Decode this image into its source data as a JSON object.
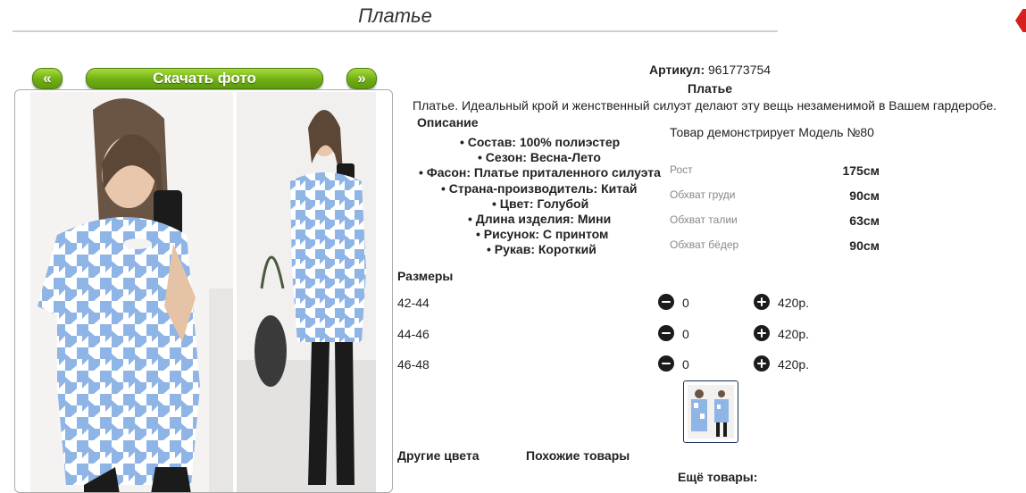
{
  "header": {
    "title": "Платье"
  },
  "gallery": {
    "prev_label": "«",
    "download_label": "Скачать фото",
    "next_label": "»"
  },
  "product": {
    "article_label": "Артикул:",
    "article_value": "961773754",
    "name": "Платье",
    "description": "Платье. Идеальный крой и женственный силуэт делают эту вещь незаменимой в Вашем гардеробе.",
    "specs_heading": "Описание",
    "specs": [
      "• Состав: 100% полиэстер",
      "• Сезон: Весна-Лето",
      "• Фасон: Платье приталенного силуэта",
      "• Страна-производитель: Китай",
      "• Цвет: Голубой",
      "• Длина изделия: Мини",
      "• Рисунок: С принтом",
      "• Рукав: Короткий"
    ]
  },
  "model": {
    "heading": "Товар демонстрирует Модель №80",
    "params": [
      {
        "label": "Рост",
        "value": "175см"
      },
      {
        "label": "Обхват груди",
        "value": "90см"
      },
      {
        "label": "Обхват талии",
        "value": "63см"
      },
      {
        "label": "Обхват бёдер",
        "value": "90см"
      }
    ]
  },
  "sizes": {
    "heading": "Размеры",
    "rows": [
      {
        "size": "42-44",
        "qty": "0",
        "price": "420р."
      },
      {
        "size": "44-46",
        "qty": "0",
        "price": "420р."
      },
      {
        "size": "46-48",
        "qty": "0",
        "price": "420р."
      }
    ]
  },
  "footer": {
    "other_colors": "Другие цвета",
    "similar": "Похожие товары",
    "more": "Ещё товары:"
  },
  "colors": {
    "accent_green": "#6fae14",
    "dress_blue": "#8fb4e6",
    "close_red": "#d62020"
  }
}
